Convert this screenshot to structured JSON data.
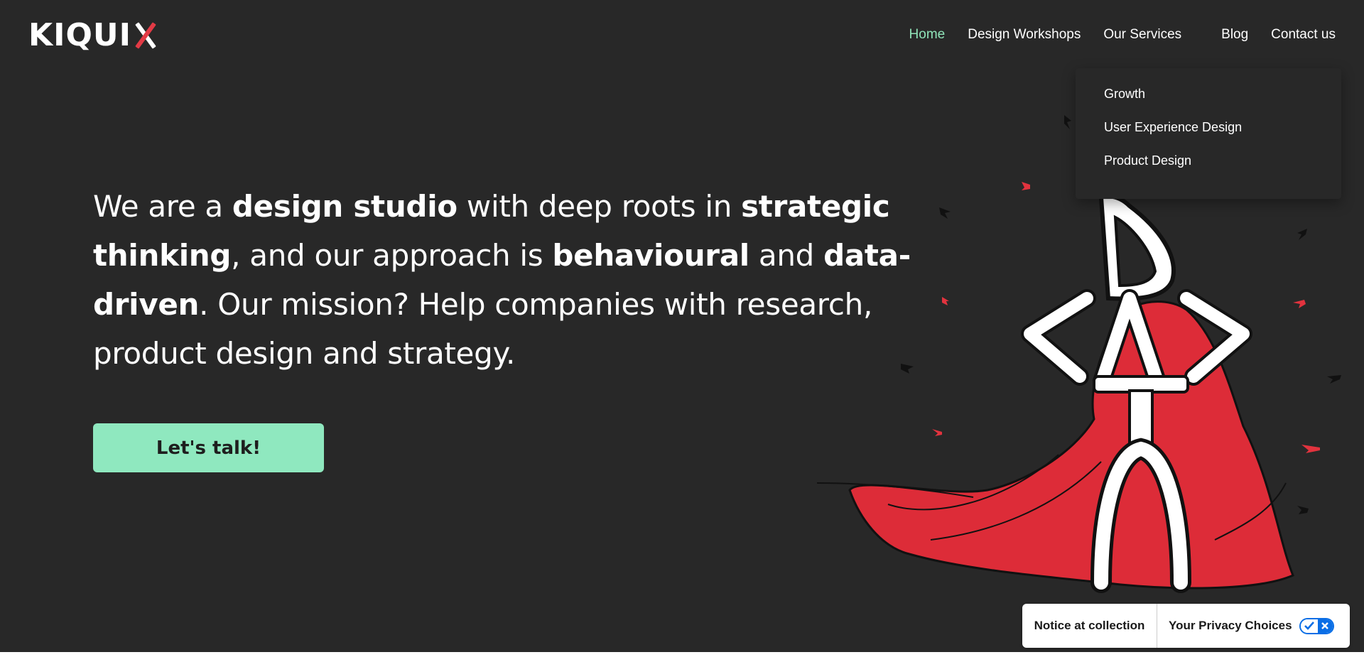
{
  "brand": {
    "logo_text": "KIQUI",
    "logo_accent_color": "#e23a45"
  },
  "nav": {
    "items": [
      {
        "label": "Home",
        "active": true
      },
      {
        "label": "Design Workshops"
      },
      {
        "label": "Our Services"
      },
      {
        "label": "Blog"
      },
      {
        "label": "Contact us"
      }
    ],
    "active_color": "#8fe3b8"
  },
  "services_menu": {
    "items": [
      "Growth",
      "User Experience Design",
      "Product Design"
    ]
  },
  "hero": {
    "segments": [
      {
        "text": "We are a ",
        "bold": false
      },
      {
        "text": "design studio",
        "bold": true
      },
      {
        "text": " with deep roots in ",
        "bold": false
      },
      {
        "text": "strategic thinking",
        "bold": true
      },
      {
        "text": ", and our approach is ",
        "bold": false
      },
      {
        "text": "behavioural",
        "bold": true
      },
      {
        "text": " and ",
        "bold": false
      },
      {
        "text": "data-driven",
        "bold": true
      },
      {
        "text": ".",
        "bold": false
      }
    ],
    "mission": "Our mission? Help companies with research, product design and strategy.",
    "cta_label": "Let's talk!",
    "cta_color": "#8fe8bf",
    "background": "#282828",
    "illustration": "data-hero-caped-figure-illustration"
  },
  "privacy": {
    "notice_label": "Notice at collection",
    "choices_label": "Your Privacy Choices",
    "toggle_icon": "privacy-choices-toggle-icon",
    "toggle_color": "#0a6ee6"
  }
}
